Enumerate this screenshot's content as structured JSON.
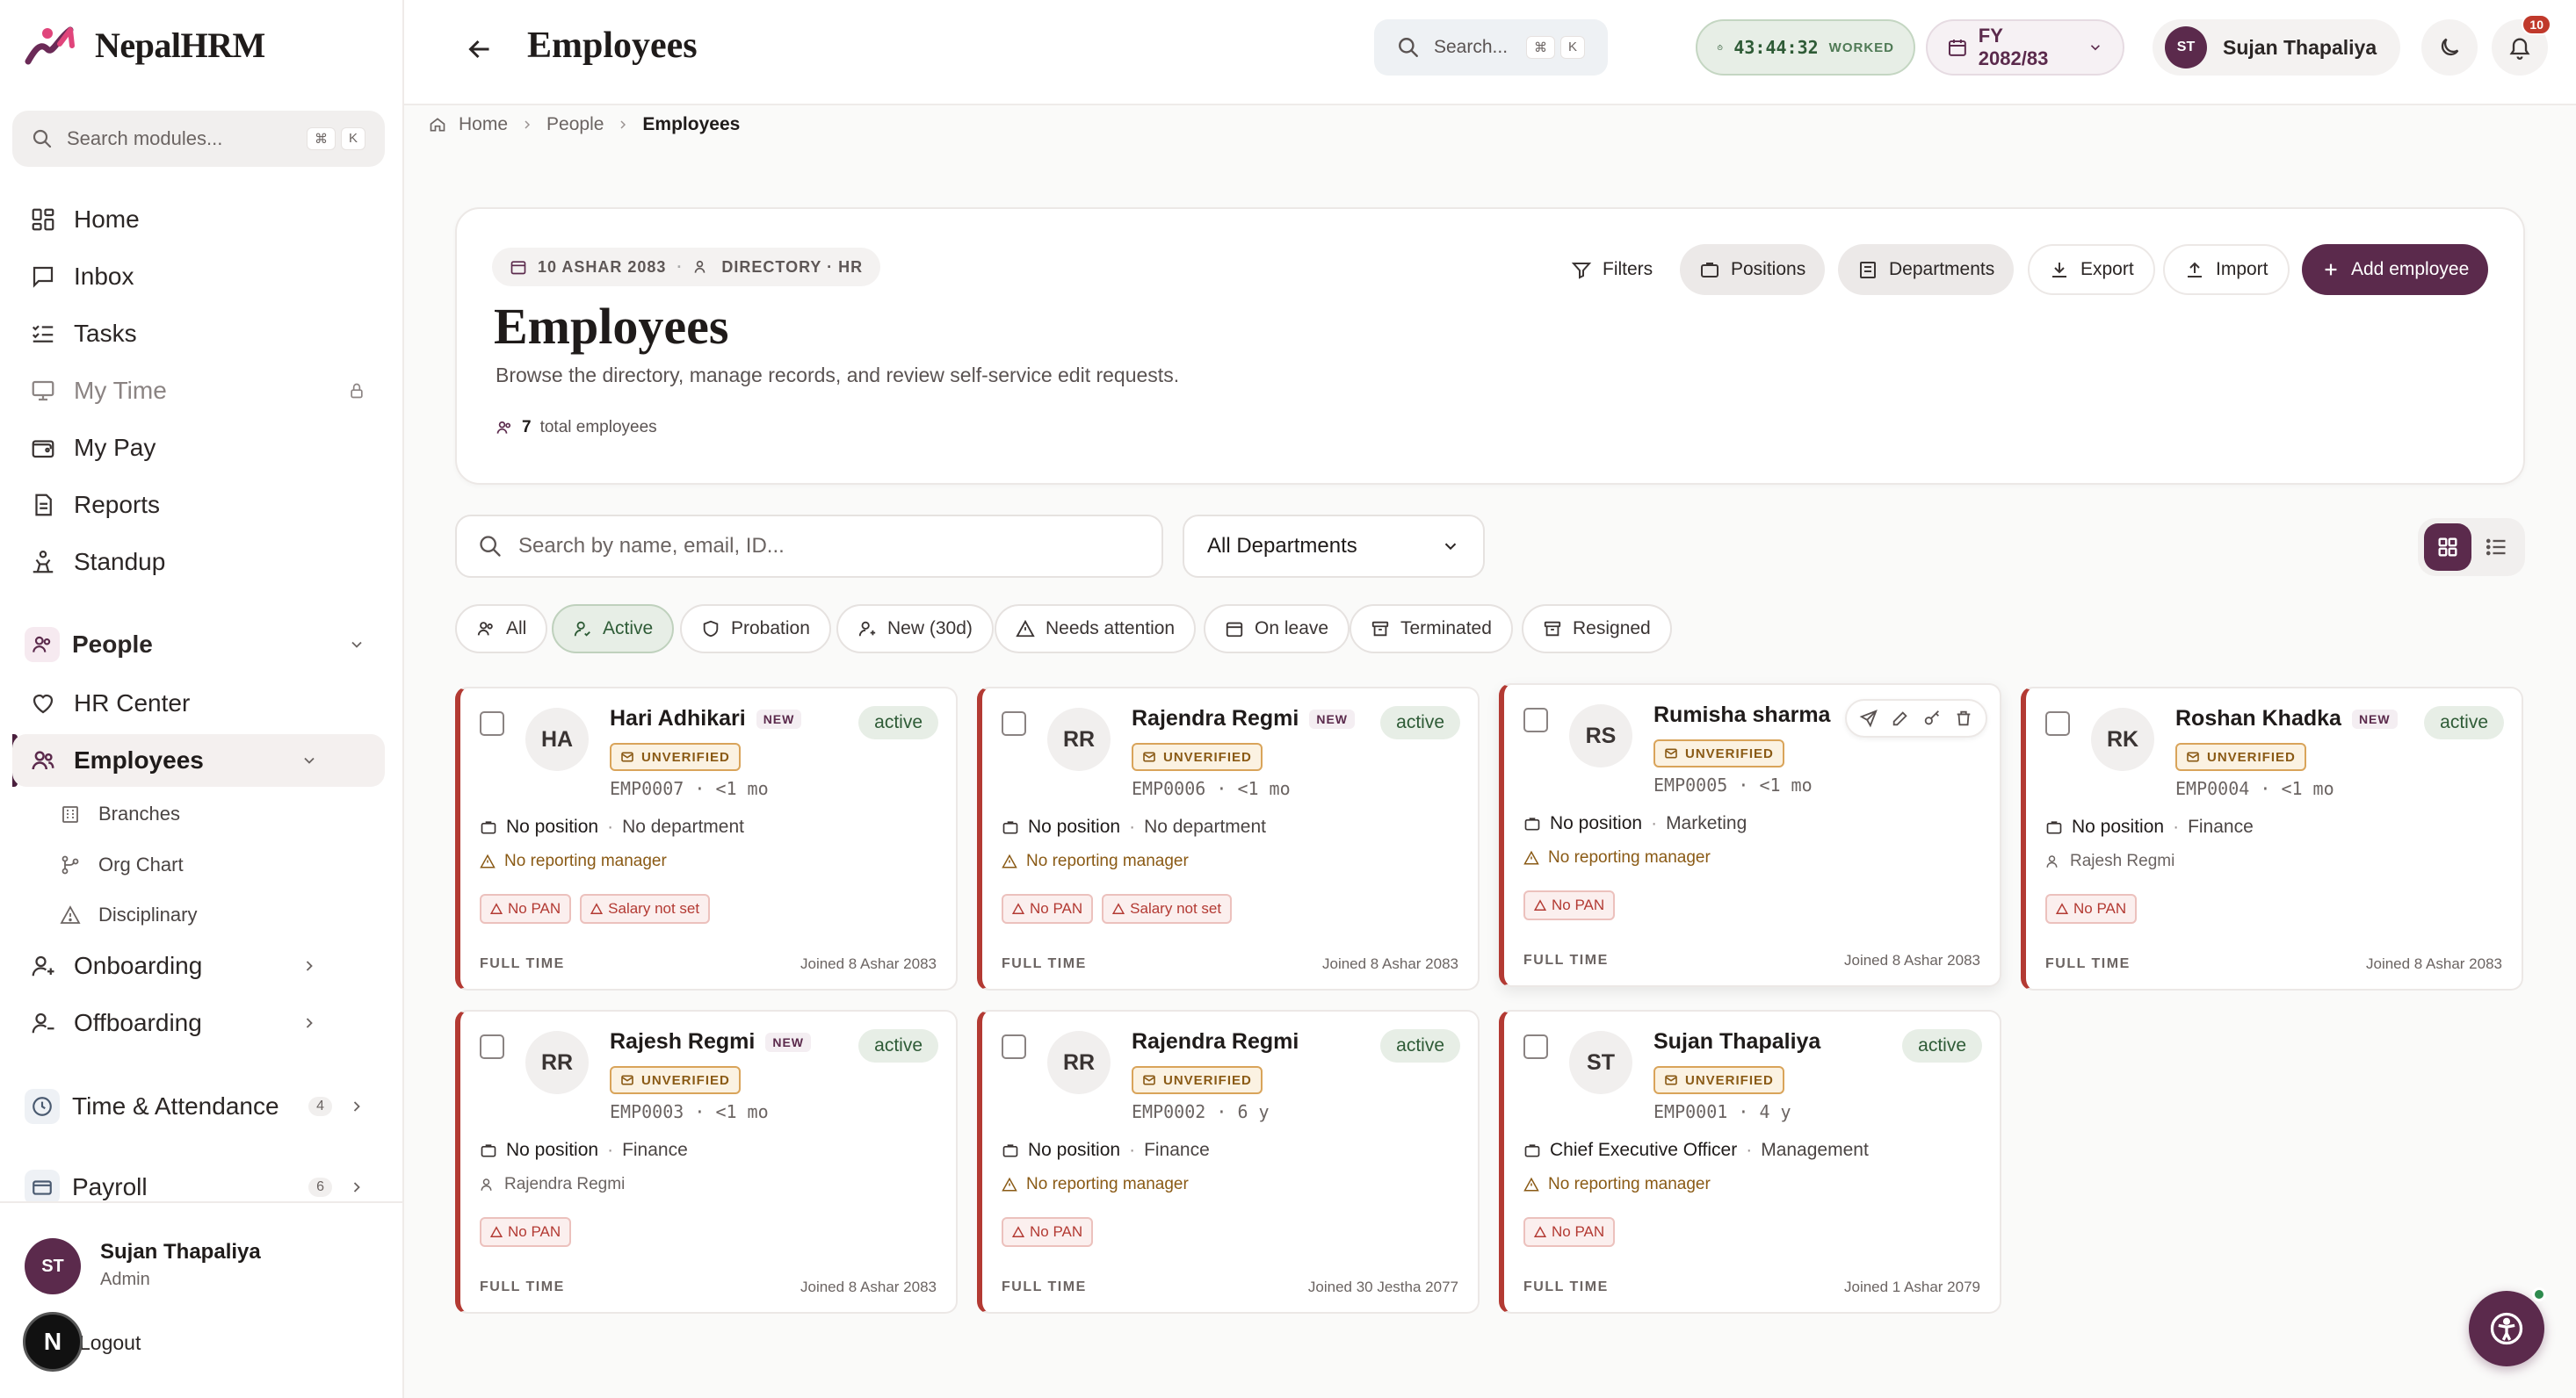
{
  "app": {
    "name": "NepalHRM"
  },
  "sidebar": {
    "search_placeholder": "Search modules...",
    "kbd": [
      "⌘",
      "K"
    ],
    "items": [
      {
        "label": "Home"
      },
      {
        "label": "Inbox"
      },
      {
        "label": "Tasks"
      },
      {
        "label": "My Time"
      },
      {
        "label": "My Pay"
      },
      {
        "label": "Reports"
      },
      {
        "label": "Standup"
      }
    ],
    "people_section": "People",
    "hr_center": "HR Center",
    "employees": "Employees",
    "sub_items": [
      {
        "label": "Branches"
      },
      {
        "label": "Org Chart"
      },
      {
        "label": "Disciplinary"
      }
    ],
    "onboarding": "Onboarding",
    "offboarding": "Offboarding",
    "time_attendance": {
      "label": "Time & Attendance",
      "count": "4"
    },
    "payroll": {
      "label": "Payroll",
      "count": "6"
    },
    "user": {
      "initials": "ST",
      "name": "Sujan Thapaliya",
      "role": "Admin"
    },
    "logout": "Logout",
    "n_badge": "N"
  },
  "topbar": {
    "title": "Employees",
    "search_placeholder": "Search...",
    "kbd": [
      "⌘",
      "K"
    ],
    "timer": {
      "value": "43:44:32",
      "label": "WORKED"
    },
    "fiscal_year": "FY 2082/83",
    "user": {
      "initials": "ST",
      "name": "Sujan Thapaliya"
    },
    "notifications": "10"
  },
  "breadcrumb": [
    "Home",
    "People",
    "Employees"
  ],
  "header": {
    "date": "10 ASHAR 2083",
    "context": "DIRECTORY · HR",
    "title": "Employees",
    "subtitle": "Browse the directory, manage records, and review self-service edit requests.",
    "total_count": "7",
    "total_label": "total employees",
    "buttons": {
      "filters": "Filters",
      "positions": "Positions",
      "departments": "Departments",
      "export": "Export",
      "import": "Import",
      "add": "Add employee"
    }
  },
  "search": {
    "placeholder": "Search by name, email, ID..."
  },
  "department_filter": {
    "selected": "All Departments"
  },
  "filter_chips": [
    {
      "label": "All"
    },
    {
      "label": "Active"
    },
    {
      "label": "Probation"
    },
    {
      "label": "New (30d)"
    },
    {
      "label": "Needs attention"
    },
    {
      "label": "On leave"
    },
    {
      "label": "Terminated"
    },
    {
      "label": "Resigned"
    }
  ],
  "labels": {
    "unverified": "UNVERIFIED",
    "new": "NEW",
    "no_position": "No position",
    "no_department": "No department",
    "no_manager": "No reporting manager",
    "no_pan": "No PAN",
    "salary_not_set": "Salary not set",
    "full_time": "FULL TIME",
    "sep": "·"
  },
  "employees": [
    {
      "initials": "HA",
      "name": "Hari Adhikari",
      "status": "active",
      "code": "EMP0007",
      "tenure": "<1 mo",
      "position": "No position",
      "department": "No department",
      "manager": "No reporting manager",
      "joined": "Joined 8 Ashar 2083"
    },
    {
      "initials": "RR",
      "name": "Rajendra Regmi",
      "status": "active",
      "code": "EMP0006",
      "tenure": "<1 mo",
      "position": "No position",
      "department": "No department",
      "manager": "No reporting manager",
      "joined": "Joined 8 Ashar 2083"
    },
    {
      "initials": "RS",
      "name": "Rumisha sharma",
      "status": "",
      "code": "EMP0005",
      "tenure": "<1 mo",
      "position": "No position",
      "department": "Marketing",
      "manager": "No reporting manager",
      "joined": "Joined 8 Ashar 2083"
    },
    {
      "initials": "RK",
      "name": "Roshan Khadka",
      "status": "active",
      "code": "EMP0004",
      "tenure": "<1 mo",
      "position": "No position",
      "department": "Finance",
      "manager": "Rajesh Regmi",
      "joined": "Joined 8 Ashar 2083"
    },
    {
      "initials": "RR",
      "name": "Rajesh Regmi",
      "status": "active",
      "code": "EMP0003",
      "tenure": "<1 mo",
      "position": "No position",
      "department": "Finance",
      "manager": "Rajendra Regmi",
      "joined": "Joined 8 Ashar 2083"
    },
    {
      "initials": "RR",
      "name": "Rajendra Regmi",
      "status": "active",
      "code": "EMP0002",
      "tenure": "6 y",
      "position": "No position",
      "department": "Finance",
      "manager": "No reporting manager",
      "joined": "Joined 30 Jestha 2077"
    },
    {
      "initials": "ST",
      "name": "Sujan Thapaliya",
      "status": "active",
      "code": "EMP0001",
      "tenure": "4 y",
      "position": "Chief Executive Officer",
      "department": "Management",
      "manager": "No reporting manager",
      "joined": "Joined 1 Ashar 2079"
    }
  ],
  "colors": {
    "brand": "#5b2a4c",
    "accent_pink": "#e0457b",
    "active_green": "#2e5b36",
    "danger": "#b33a33",
    "warning": "#8a5a15"
  },
  "icons": [
    "home-icon",
    "inbox-icon",
    "tasks-icon",
    "monitor-icon",
    "wallet-icon",
    "reports-icon",
    "standup-icon",
    "people-icon",
    "heart-hand-icon",
    "employees-icon",
    "building-icon",
    "org-chart-icon",
    "warning-icon",
    "user-plus-icon",
    "user-minus-icon",
    "clock-icon",
    "payroll-icon",
    "search-icon",
    "calendar-icon",
    "moon-icon",
    "bell-icon",
    "filter-icon",
    "download-icon",
    "upload-icon",
    "plus-icon",
    "grid-icon",
    "list-icon",
    "accessibility-icon"
  ]
}
